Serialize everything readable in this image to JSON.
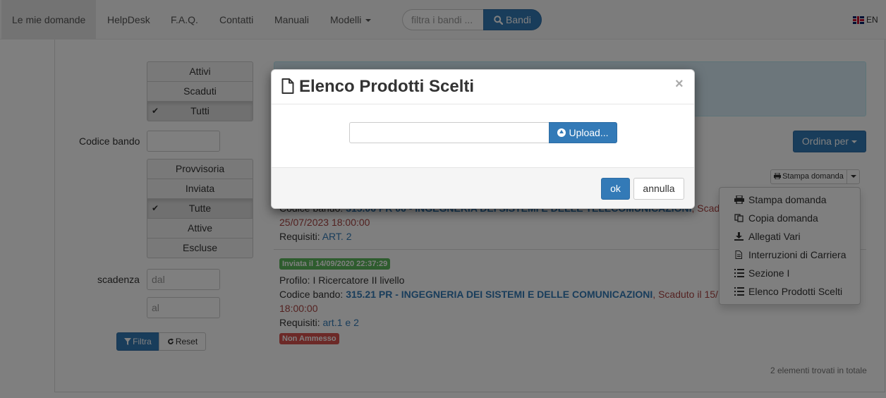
{
  "navbar": {
    "items": [
      {
        "label": "Le mie domande",
        "active": true
      },
      {
        "label": "HelpDesk"
      },
      {
        "label": "F.A.Q."
      },
      {
        "label": "Contatti"
      },
      {
        "label": "Manuali"
      },
      {
        "label": "Modelli"
      }
    ],
    "search_placeholder": "filtra i bandi ...",
    "search_button": "Bandi",
    "language": "EN"
  },
  "filters": {
    "status_group": [
      {
        "label": "Attivi",
        "selected": false
      },
      {
        "label": "Scaduti",
        "selected": false
      },
      {
        "label": "Tutti",
        "selected": true
      }
    ],
    "codice_bando_label": "Codice bando",
    "codice_bando_value": "",
    "state_group": [
      {
        "label": "Provvisoria",
        "selected": false
      },
      {
        "label": "Inviata",
        "selected": false
      },
      {
        "label": "Tutte",
        "selected": true
      },
      {
        "label": "Attive",
        "selected": false
      },
      {
        "label": "Escluse",
        "selected": false
      }
    ],
    "scadenza_label": "scadenza",
    "dal_placeholder": "dal",
    "al_placeholder": "al",
    "check_symbol": "✔",
    "filtra_label": "Filtra",
    "reset_label": "Reset"
  },
  "toolbar": {
    "ordina_label": "Ordina per",
    "stampa_label": "Stampa domanda"
  },
  "items": [
    {
      "codice_prefix": "Codice bando:",
      "codice_value": "315.06 PR 06 - INGEGNERIA DEI SISTEMI E DELLE TELECOMUNICAZIONI",
      "scaduto_text": ", Scad",
      "date": "25/07/2023 18:00:00",
      "requisiti_label": "Requisiti:",
      "requisiti_value": "ART. 2"
    },
    {
      "badge": "Inviata il 14/09/2020 22:37:29",
      "profilo": "Profilo: I Ricercatore II livello",
      "codice_prefix": "Codice bando:",
      "codice_value": "315.21 PR - INGEGNERIA DEI SISTEMI E DELLE COMUNICAZIONI",
      "scaduto_text": ", Scaduto il 15/",
      "date": "18:00:00",
      "requisiti_label": "Requisiti:",
      "requisiti_value": "art.1 e 2",
      "status_badge": "Non Ammesso"
    }
  ],
  "dropdown": {
    "items": [
      {
        "label": "Stampa domanda",
        "icon": "print-icon"
      },
      {
        "label": "Copia domanda",
        "icon": "copy-icon"
      },
      {
        "label": "Allegati Vari",
        "icon": "download-icon"
      },
      {
        "label": "Interruzioni di Carriera",
        "icon": "file-icon"
      },
      {
        "label": "Sezione I",
        "icon": "list-icon"
      },
      {
        "label": "Elenco Prodotti Scelti",
        "icon": "list-icon"
      }
    ]
  },
  "footer": {
    "count_text": "2 elementi trovati in totale"
  },
  "modal": {
    "title": "Elenco Prodotti Scelti",
    "close": "×",
    "upload_value": "",
    "upload_label": "Upload...",
    "ok_label": "ok",
    "annulla_label": "annulla"
  }
}
